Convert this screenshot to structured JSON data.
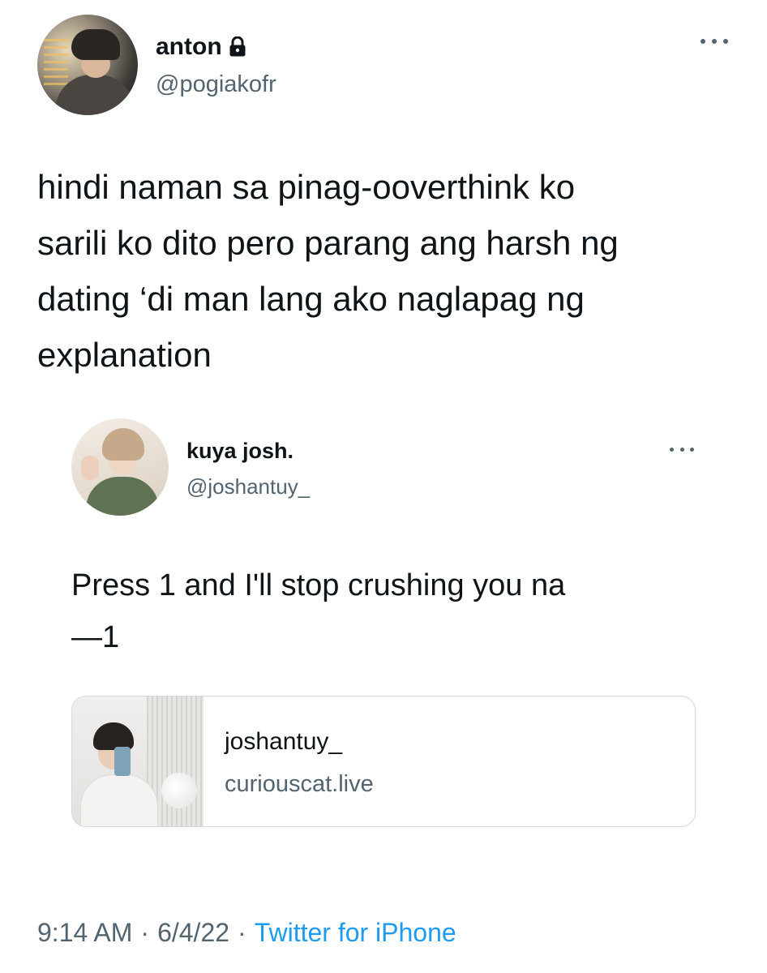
{
  "tweet": {
    "display_name": "anton",
    "handle": "@pogiakofr",
    "protected_icon": "lock-icon",
    "text": "hindi naman sa pinag-ooverthink ko\nsarili ko dito pero parang ang harsh ng\ndating ‘di man lang ako naglapag ng\nexplanation",
    "time": "9:14 AM",
    "date": "6/4/22",
    "separator": "·",
    "source": "Twitter for iPhone"
  },
  "quoted_tweet": {
    "display_name": "kuya josh.",
    "handle": "@joshantuy_",
    "text": "Press 1 and I'll stop crushing you na\n—1",
    "link_card": {
      "title": "joshantuy_",
      "domain": "curiouscat.live"
    }
  },
  "colors": {
    "text_primary": "#0f1419",
    "text_secondary": "#536471",
    "link_blue": "#1d9bf0",
    "card_border": "#cfd9de"
  }
}
